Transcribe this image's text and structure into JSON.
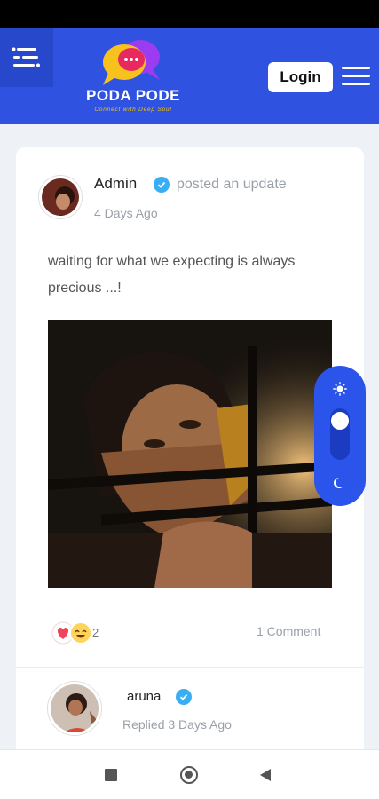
{
  "app": {
    "title": "PODA PODE",
    "tagline": "Connect with Deep Soul"
  },
  "header": {
    "login_label": "Login"
  },
  "post": {
    "author": "Admin",
    "action": "posted an update",
    "time": "4 Days Ago",
    "text_line1": "waiting for what we expecting is always",
    "text_line2": "precious ...!",
    "reaction_count": "2",
    "comments": "1 Comment"
  },
  "reply": {
    "author": "aruna",
    "time": "Replied 3 Days Ago"
  },
  "icons": [
    "sidebar-toggle-icon",
    "chat-bubbles-logo",
    "hamburger-menu-icon",
    "verified-icon",
    "heart-reaction-icon",
    "laugh-reaction-icon",
    "sun-icon",
    "moon-icon",
    "recent-apps-icon",
    "home-icon",
    "back-icon"
  ],
  "colors": {
    "brand": "#2f52e0",
    "verified": "#3aaef3",
    "accent": "#2b55ea"
  }
}
